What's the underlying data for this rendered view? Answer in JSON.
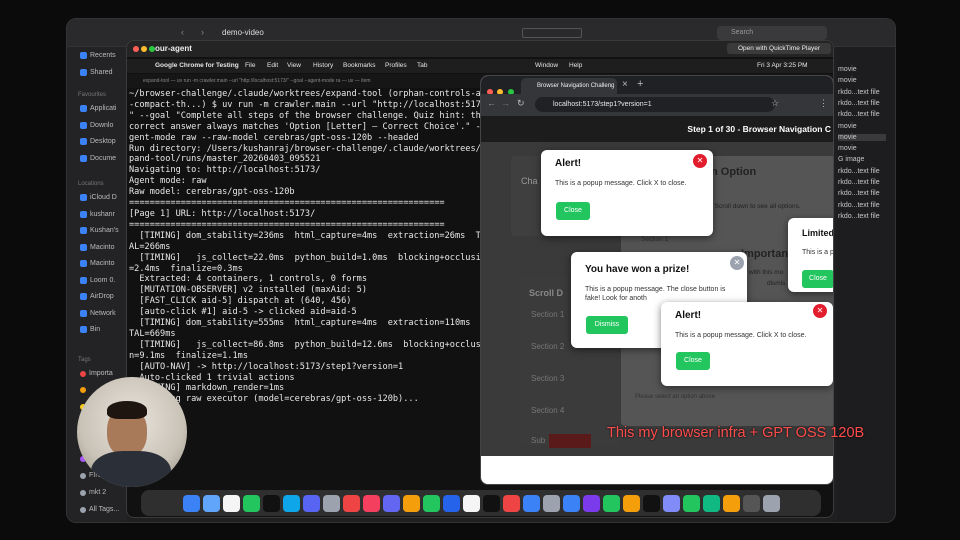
{
  "finder": {
    "title": "demo-video",
    "search_placeholder": "Search",
    "sidebar": {
      "items_top": [
        "Recents",
        "Shared"
      ],
      "favorites_head": "Favourites",
      "items_fav": [
        "Applicati",
        "Downlo",
        "Desktop",
        "Docume"
      ],
      "locations_head": "Locations",
      "items_loc": [
        "iCloud D",
        "kushanr",
        "Kushan's",
        "Macinto",
        "Macinto",
        "Loom 0.",
        "AirDrop",
        "Network",
        "Bin"
      ],
      "tags_head": "Tags",
      "items_tags": [
        "Importa",
        "",
        "",
        "",
        "",
        "Be",
        "FIN ACC",
        "mkt 2",
        "All Tags..."
      ]
    },
    "right_items": [
      "movie",
      "movie",
      "rkdo...text file",
      "rkdo...text file",
      "rkdo...text file",
      "movie",
      "movie",
      "movie",
      "G image",
      "rkdo...text file",
      "rkdo...text file",
      "rkdo...text file",
      "rkdo...text file",
      "rkdo...text file"
    ],
    "open_button": "Open with QuickTime Player"
  },
  "terminal": {
    "window_title": "our-agent",
    "menubar": [
      "Google Chrome for Testing",
      "File",
      "Edit",
      "View",
      "History",
      "Bookmarks",
      "Profiles",
      "Tab",
      "Window",
      "Help"
    ],
    "clock": "Fri 3 Apr  3:25 PM",
    "tab_text": "expand-tool — uv run -m crawler.main --url \"http://localhost:5173/\" --goal --agent-mode ra — uv — item",
    "lines": [
      "~/browser-challenge/.claude/worktrees/expand-tool (orphan-controls-a",
      "-compact-th...) $ uv run -m crawler.main --url \"http://localhost:517",
      "\" --goal \"Complete all steps of the browser challenge. Quiz hint: th",
      "correct answer always matches 'Option [Letter] — Correct Choice'.\" -",
      "gent-mode raw --raw-model cerebras/gpt-oss-120b --headed",
      "Run directory: /Users/kushanraj/browser-challenge/.claude/worktrees/",
      "pand-tool/runs/master_20260403_095521",
      "Navigating to: http://localhost:5173/",
      "Agent mode: raw",
      "Raw model: cerebras/gpt-oss-120b",
      "",
      "=============================================================",
      "[Page 1] URL: http://localhost:5173/",
      "=============================================================",
      "  [TIMING] dom_stability=236ms  html_capture=4ms  extraction=26ms  T",
      "AL=266ms",
      "  [TIMING]   js_collect=22.0ms  python_build=1.0ms  blocking+occlusi",
      "=2.4ms  finalize=0.3ms",
      "  Extracted: 4 containers, 1 controls, 0 forms",
      "  [MUTATION-OBSERVER] v2 installed (maxAid: 5)",
      "  [FAST_CLICK aid-5] dispatch at (640, 456)",
      "  [auto-click #1] aid-5 -> clicked aid=aid-5",
      "  [TIMING] dom_stability=555ms  html_capture=4ms  extraction=110ms",
      "TAL=669ms",
      "  [TIMING]   js_collect=86.8ms  python_build=12.6ms  blocking+occlus",
      "n=9.1ms  finalize=1.1ms",
      "  [AUTO-NAV] -> http://localhost:5173/step1?version=1",
      "  Auto-clicked 1 trivial actions",
      "  [TIMING] markdown_render=1ms",
      "  Spawning raw executor (model=cerebras/gpt-oss-120b)..."
    ]
  },
  "chrome": {
    "tab_title": "Browser Navigation Challeng",
    "url": "localhost:5173/step1?version=1",
    "header": "Step 1 of 30 - Browser Navigation C",
    "bg_labels": {
      "option": "n Option",
      "cha": "Cha",
      "scroll_hint": "al. Scroll down to see all options.",
      "section1": "Section 1",
      "important": "Importan",
      "with_this": "with this mo",
      "dismiss": "dismis",
      "scroll": "Scroll D",
      "sections": [
        "Section 1",
        "Section 2",
        "Section 3",
        "Section 4"
      ],
      "sub": "Sub",
      "please": "Please select an option above"
    },
    "popups": {
      "alert1": {
        "title": "Alert!",
        "text": "This is a popup message. Click X to close.",
        "button": "Close"
      },
      "prize": {
        "title": "You have won a prize!",
        "text": "This is a popup message. The close button is fake! Look for anoth",
        "button": "Dismiss"
      },
      "alert2": {
        "title": "Alert!",
        "text": "This is a popup message. Click X to close.",
        "button": "Close"
      },
      "limited": {
        "title": "Limited",
        "text": "This is a p",
        "button": "Close"
      }
    }
  },
  "caption": "This my browser infra + GPT OSS 120B",
  "colors": {
    "accent_green": "#22c55e",
    "close_red": "#e11d2e",
    "caption": "#ff4d4d"
  }
}
